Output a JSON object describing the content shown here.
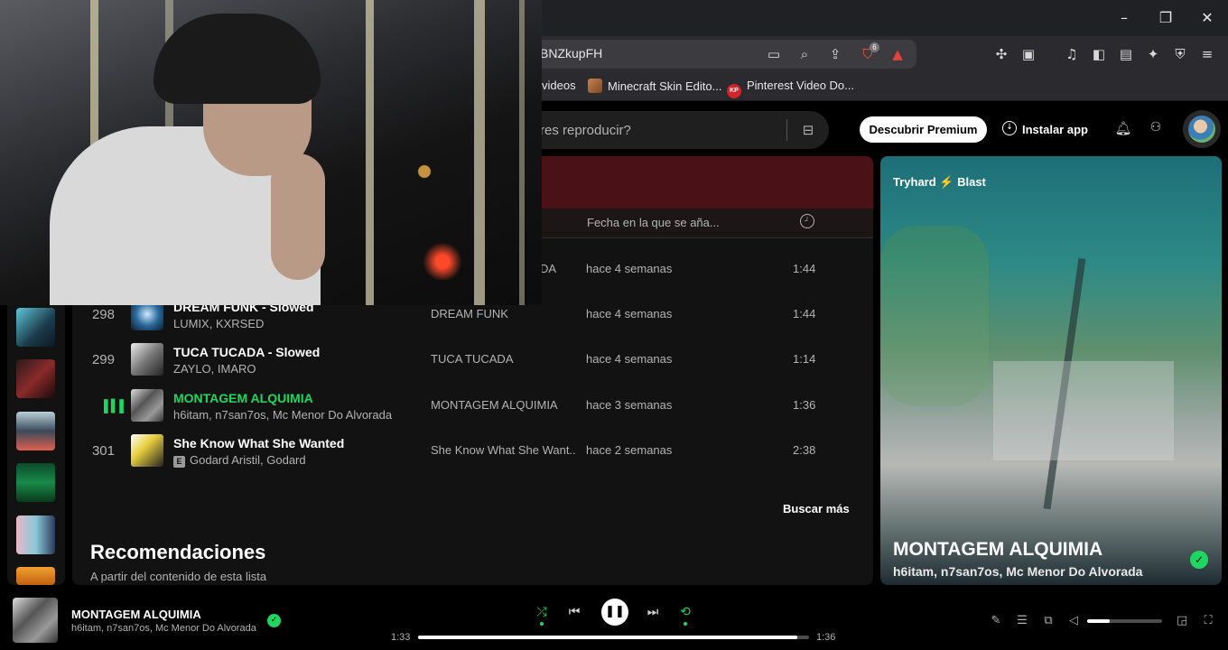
{
  "browser": {
    "url_fragment": "BNZkupFH",
    "shields_badge": "6",
    "bookmarks": [
      {
        "label": "videos"
      },
      {
        "label": "Minecraft Skin Edito..."
      },
      {
        "label": "Pinterest Video Do...",
        "badge": "KP"
      }
    ]
  },
  "topbar": {
    "search_placeholder": "res reproducir?",
    "premium_label": "Descubrir Premium",
    "install_label": "Instalar app"
  },
  "tracklist": {
    "col_date": "Fecha en la que se aña...",
    "partial_album_first": "DA",
    "rows": [
      {
        "num": "",
        "title": "",
        "artist": "",
        "album": "",
        "date": "hace 4 semanas",
        "duration": "1:44",
        "playing": false,
        "explicit": false
      },
      {
        "num": "298",
        "title": "DREAM FUNK - Slowed",
        "artist": "LUMIX, KXRSED",
        "album": "DREAM FUNK",
        "date": "hace 4 semanas",
        "duration": "1:44",
        "playing": false,
        "explicit": false
      },
      {
        "num": "299",
        "title": "TUCA TUCADA - Slowed",
        "artist": "ZAYLO, IMARO",
        "album": "TUCA TUCADA",
        "date": "hace 4 semanas",
        "duration": "1:14",
        "playing": false,
        "explicit": false
      },
      {
        "num": "",
        "title": "MONTAGEM ALQUIMIA",
        "artist": "h6itam, n7san7os, Mc Menor Do Alvorada",
        "album": "MONTAGEM ALQUIMIA",
        "date": "hace 3 semanas",
        "duration": "1:36",
        "playing": true,
        "explicit": false
      },
      {
        "num": "301",
        "title": "She Know What She Wanted",
        "artist": "Godard Aristil, Godard",
        "album": "She Know What She Want...",
        "date": "hace 2 semanas",
        "duration": "2:38",
        "playing": false,
        "explicit": true
      }
    ],
    "explicit_label": "E",
    "more_label": "Buscar más"
  },
  "recommendations": {
    "title": "Recomendaciones",
    "subtitle": "A partir del contenido de esta lista"
  },
  "now_playing_panel": {
    "playlist_name": "Tryhard ⚡ Blast",
    "title": "MONTAGEM ALQUIMIA",
    "artist": "h6itam, n7san7os, Mc Menor Do Alvorada"
  },
  "player": {
    "title": "MONTAGEM ALQUIMIA",
    "artist": "h6itam, n7san7os, Mc Menor Do Alvorada",
    "time_current": "1:33",
    "time_total": "1:36",
    "progress": 0.97,
    "volume": 0.3
  },
  "colors": {
    "accent": "#1ed760",
    "header_red": "#4a1216",
    "panel": "#121212"
  }
}
